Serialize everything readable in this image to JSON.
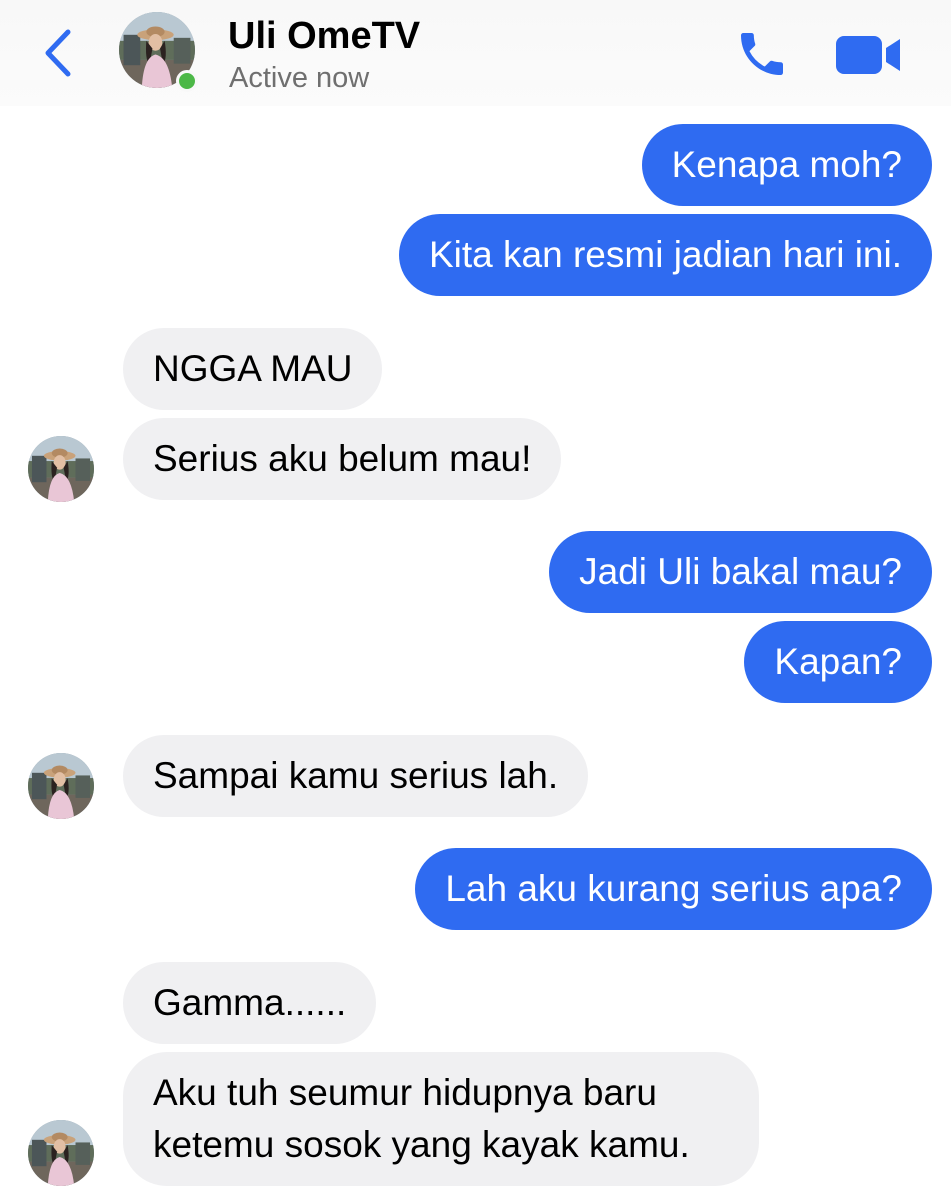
{
  "header": {
    "contact_name": "Uli OmeTV",
    "status": "Active now",
    "accent_color": "#2f6bf1",
    "online_color": "#4cb847"
  },
  "icons": [
    "back-chevron-icon",
    "phone-icon",
    "video-camera-icon",
    "contact-avatar",
    "online-status-dot"
  ],
  "messages": [
    {
      "from": "me",
      "text": "Kenapa moh?"
    },
    {
      "from": "me",
      "text": "Kita kan resmi jadian hari ini."
    },
    {
      "from": "contact",
      "text": "NGGA MAU"
    },
    {
      "from": "contact",
      "text": "Serius aku belum mau!"
    },
    {
      "from": "me",
      "text": "Jadi Uli bakal mau?"
    },
    {
      "from": "me",
      "text": "Kapan?"
    },
    {
      "from": "contact",
      "text": "Sampai kamu serius lah."
    },
    {
      "from": "me",
      "text": "Lah aku kurang serius apa?"
    },
    {
      "from": "contact",
      "text": "Gamma......"
    },
    {
      "from": "contact",
      "text": "Aku tuh seumur hidupnya baru ketemu sosok yang kayak kamu."
    }
  ]
}
